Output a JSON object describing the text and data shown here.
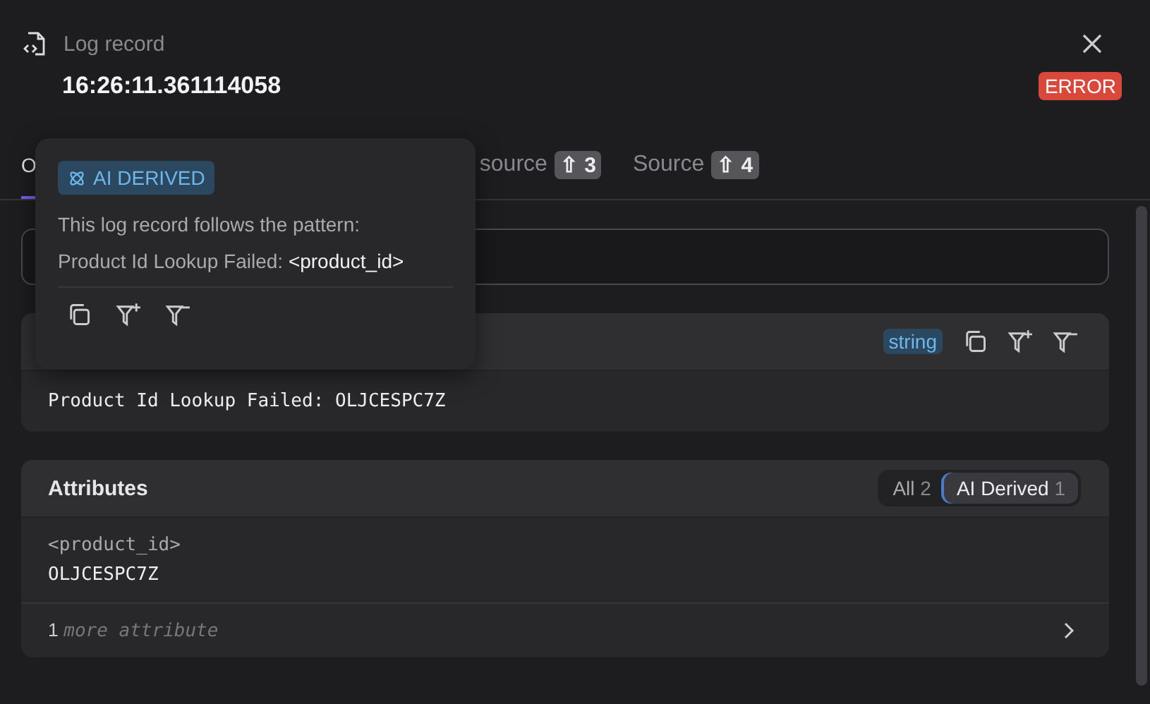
{
  "header": {
    "title": "Log record",
    "timestamp": "16:26:11.361114058",
    "severity": "ERROR"
  },
  "tabs": [
    {
      "label": "O",
      "selected": true
    },
    {
      "label": "source",
      "badge": "⇧ 3",
      "selected": false
    },
    {
      "label": "Source",
      "badge": "⇧ 4",
      "selected": false
    }
  ],
  "body": {
    "type_badge": "string",
    "value": "Product Id Lookup Failed: OLJCESPC7Z"
  },
  "attributes": {
    "title": "Attributes",
    "filters": [
      {
        "label": "All",
        "count": "2",
        "selected": false
      },
      {
        "label": "AI Derived",
        "count": "1",
        "selected": true
      }
    ],
    "items": [
      {
        "key": "<product_id>",
        "value": "OLJCESPC7Z"
      }
    ],
    "more_count": "1",
    "more_label": "more attribute"
  },
  "popover": {
    "badge": "AI DERIVED",
    "intro": "This log record follows the pattern:",
    "pattern_prefix": "Product Id Lookup Failed:",
    "pattern_token": "<product_id>"
  }
}
